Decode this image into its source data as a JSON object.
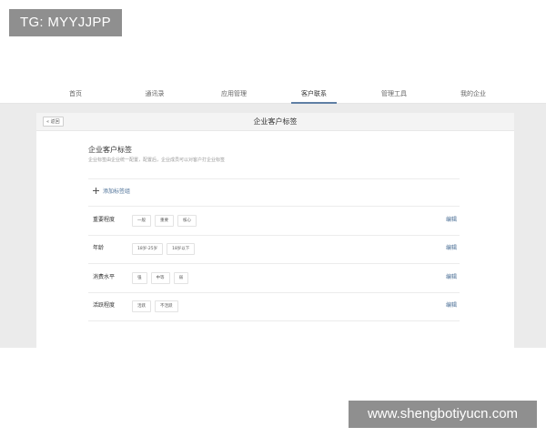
{
  "watermarks": {
    "top_left": "TG: MYYJJPP",
    "bottom_right": "www.shengbotiyucn.com"
  },
  "nav": {
    "items": [
      {
        "label": "首页",
        "active": false
      },
      {
        "label": "通讯录",
        "active": false
      },
      {
        "label": "应用管理",
        "active": false
      },
      {
        "label": "客户联系",
        "active": true
      },
      {
        "label": "管理工具",
        "active": false
      },
      {
        "label": "我的企业",
        "active": false
      }
    ]
  },
  "card": {
    "back_label": "« 返回",
    "title": "企业客户标签"
  },
  "section": {
    "title": "企业客户标签",
    "description": "企业标签由企业统一配置，配置后，企业成员可以对客户打企业标签",
    "add_group_label": "添加标签组",
    "edit_label": "编辑"
  },
  "tag_groups": [
    {
      "label": "重要程度",
      "tags": [
        "一般",
        "重要",
        "核心"
      ]
    },
    {
      "label": "年龄",
      "tags": [
        "18岁-25岁",
        "18岁以下"
      ]
    },
    {
      "label": "消费水平",
      "tags": [
        "强",
        "中等",
        "弱"
      ]
    },
    {
      "label": "活跃程度",
      "tags": [
        "活跃",
        "不活跃"
      ]
    }
  ],
  "colors": {
    "accent": "#4b6f96",
    "workspace_bg": "#ebebeb",
    "watermark_bg": "#8f8f8f"
  }
}
